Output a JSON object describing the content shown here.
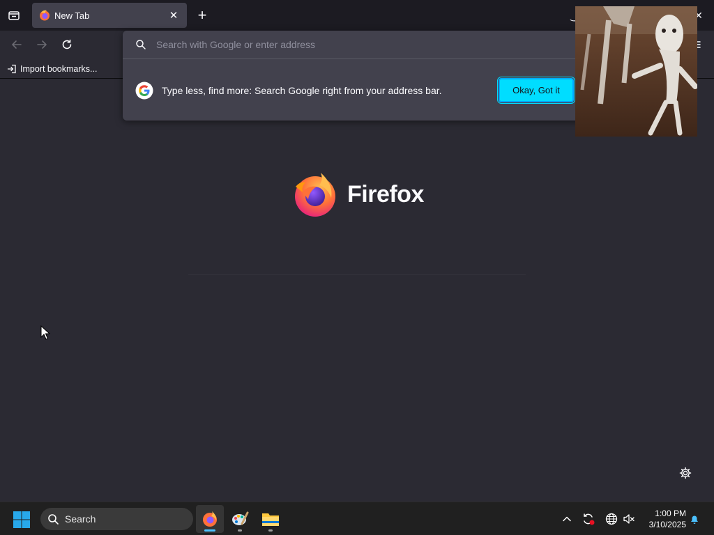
{
  "tab": {
    "title": "New Tab",
    "close_glyph": "✕"
  },
  "new_tab_glyph": "+",
  "window_controls": {
    "minimize_glyph": "‿",
    "close_glyph": "✕"
  },
  "urlbar": {
    "placeholder": "Search with Google or enter address"
  },
  "bookmarks": {
    "import_label": "Import bookmarks..."
  },
  "tip": {
    "text": "Type less, find more: Search Google right from your address bar.",
    "button_label": "Okay, Got it"
  },
  "newtab": {
    "brand": "Firefox"
  },
  "taskbar": {
    "search_label": "Search",
    "clock_time": "1:00 PM",
    "clock_date": "3/10/2025",
    "apps": [
      {
        "name": "Firefox",
        "icon": "firefox-icon",
        "active": true
      },
      {
        "name": "Paint",
        "icon": "paint-palette-icon",
        "active": false
      },
      {
        "name": "File Explorer",
        "icon": "folder-icon",
        "active": false
      }
    ]
  },
  "colors": {
    "accent": "#00ddff",
    "toolbar": "#2b2a33",
    "tabstrip": "#1c1b22",
    "popup": "#42414d",
    "taskbar": "#202020",
    "windows_blue": "#0078d4"
  }
}
